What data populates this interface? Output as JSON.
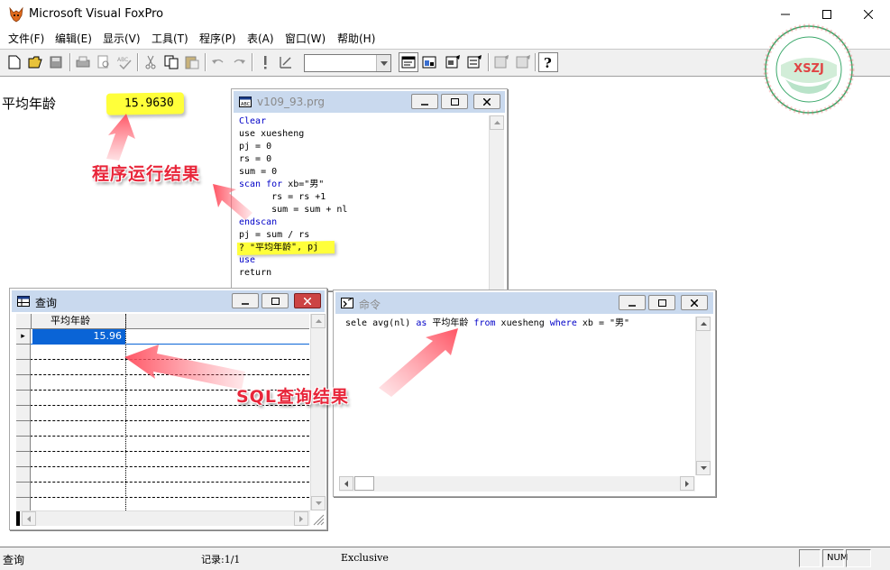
{
  "app": {
    "title": "Microsoft Visual FoxPro"
  },
  "menu": [
    "文件(F)",
    "编辑(E)",
    "显示(V)",
    "工具(T)",
    "程序(P)",
    "表(A)",
    "窗口(W)",
    "帮助(H)"
  ],
  "output": {
    "label": "平均年龄",
    "value": "15.9630"
  },
  "annotations": {
    "program_result": "程序运行结果",
    "sql_result": "SQL查询结果"
  },
  "logo": {
    "text": "XSZJ"
  },
  "program_window": {
    "title": "v109_93.prg",
    "lines": [
      {
        "text": "Clear",
        "kw": true
      },
      {
        "text": "use xuesheng",
        "kw": false
      },
      {
        "text": "pj = 0",
        "kw": false
      },
      {
        "text": "rs = 0",
        "kw": false
      },
      {
        "text": "sum = 0",
        "kw": false
      },
      {
        "text": "scan for xb=\"男\"",
        "kw": false
      },
      {
        "text": "      rs = rs +1",
        "kw": false
      },
      {
        "text": "      sum = sum + nl",
        "kw": false
      },
      {
        "text": "endscan",
        "kw": true
      },
      {
        "text": "pj = sum / rs",
        "kw": false
      },
      {
        "text": "? \"平均年龄\", pj",
        "kw": false
      },
      {
        "text": "use",
        "kw": true
      },
      {
        "text": "return",
        "kw": false
      }
    ]
  },
  "query_window": {
    "title": "查询",
    "column_header": "平均年龄",
    "rows": [
      "15.96"
    ],
    "row_marker": "▸"
  },
  "command_window": {
    "title": "命令",
    "command": "sele avg(nl) as 平均年龄 from xuesheng where xb = \"男\""
  },
  "status": {
    "left": "查询",
    "record": "记录:1/1",
    "mode": "Exclusive",
    "num": "NUM"
  }
}
